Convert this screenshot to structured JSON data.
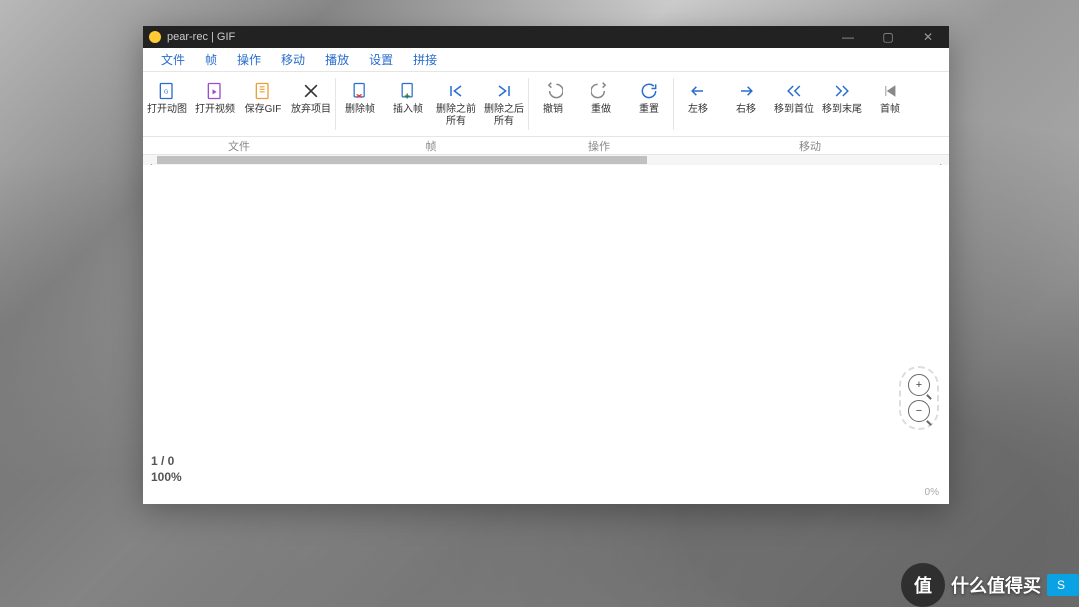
{
  "title": "pear-rec | GIF",
  "window_controls": {
    "min": "—",
    "max": "▢",
    "close": "✕"
  },
  "menus": {
    "file": "文件",
    "frame": "帧",
    "operate": "操作",
    "move": "移动",
    "play": "播放",
    "settings": "设置",
    "splice": "拼接"
  },
  "toolbar": {
    "file": {
      "open_animation": "打开动图",
      "open_video": "打开视频",
      "save_gif": "保存GIF",
      "cancel_project": "放弃项目"
    },
    "frame": {
      "delete_frame": "删除帧",
      "insert_frame": "插入帧",
      "delete_before": "删除之前所有",
      "delete_after": "删除之后所有"
    },
    "operate": {
      "undo": "撤销",
      "redo": "重做",
      "reset": "重置"
    },
    "move": {
      "left": "左移",
      "right": "右移",
      "to_first": "移到首位",
      "to_last": "移到末尾",
      "first_frame": "首帧"
    }
  },
  "groups": {
    "file": "文件",
    "frame": "帧",
    "operate": "操作",
    "move": "移动"
  },
  "status": {
    "frame_counter": "1 / 0",
    "zoom": "100%",
    "progress_right": "0%"
  },
  "zoom_panel": {
    "in": "+",
    "out": "−"
  },
  "watermark": {
    "logo_char": "值",
    "text": "什么值得买",
    "tag": "S"
  }
}
